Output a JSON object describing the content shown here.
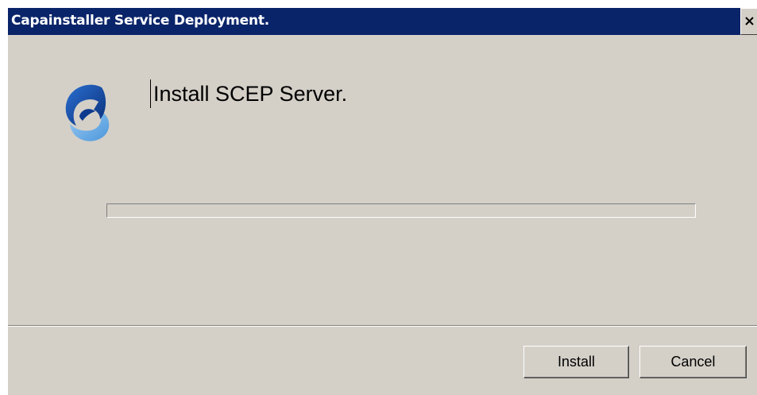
{
  "window": {
    "title": "Capainstaller Service Deployment."
  },
  "titlebar": {
    "close_icon": "close-icon",
    "close_glyph": "✕"
  },
  "main": {
    "logo_icon": "capainstaller-logo",
    "heading": "Install SCEP Server.",
    "progress_percent": 0
  },
  "buttons": {
    "install_label": "Install",
    "cancel_label": "Cancel"
  },
  "colors": {
    "titlebar": "#0a246a",
    "dialog_background": "#d4d0c8",
    "logo_dark": "#0d3a8e",
    "logo_light": "#5aa4e0"
  }
}
